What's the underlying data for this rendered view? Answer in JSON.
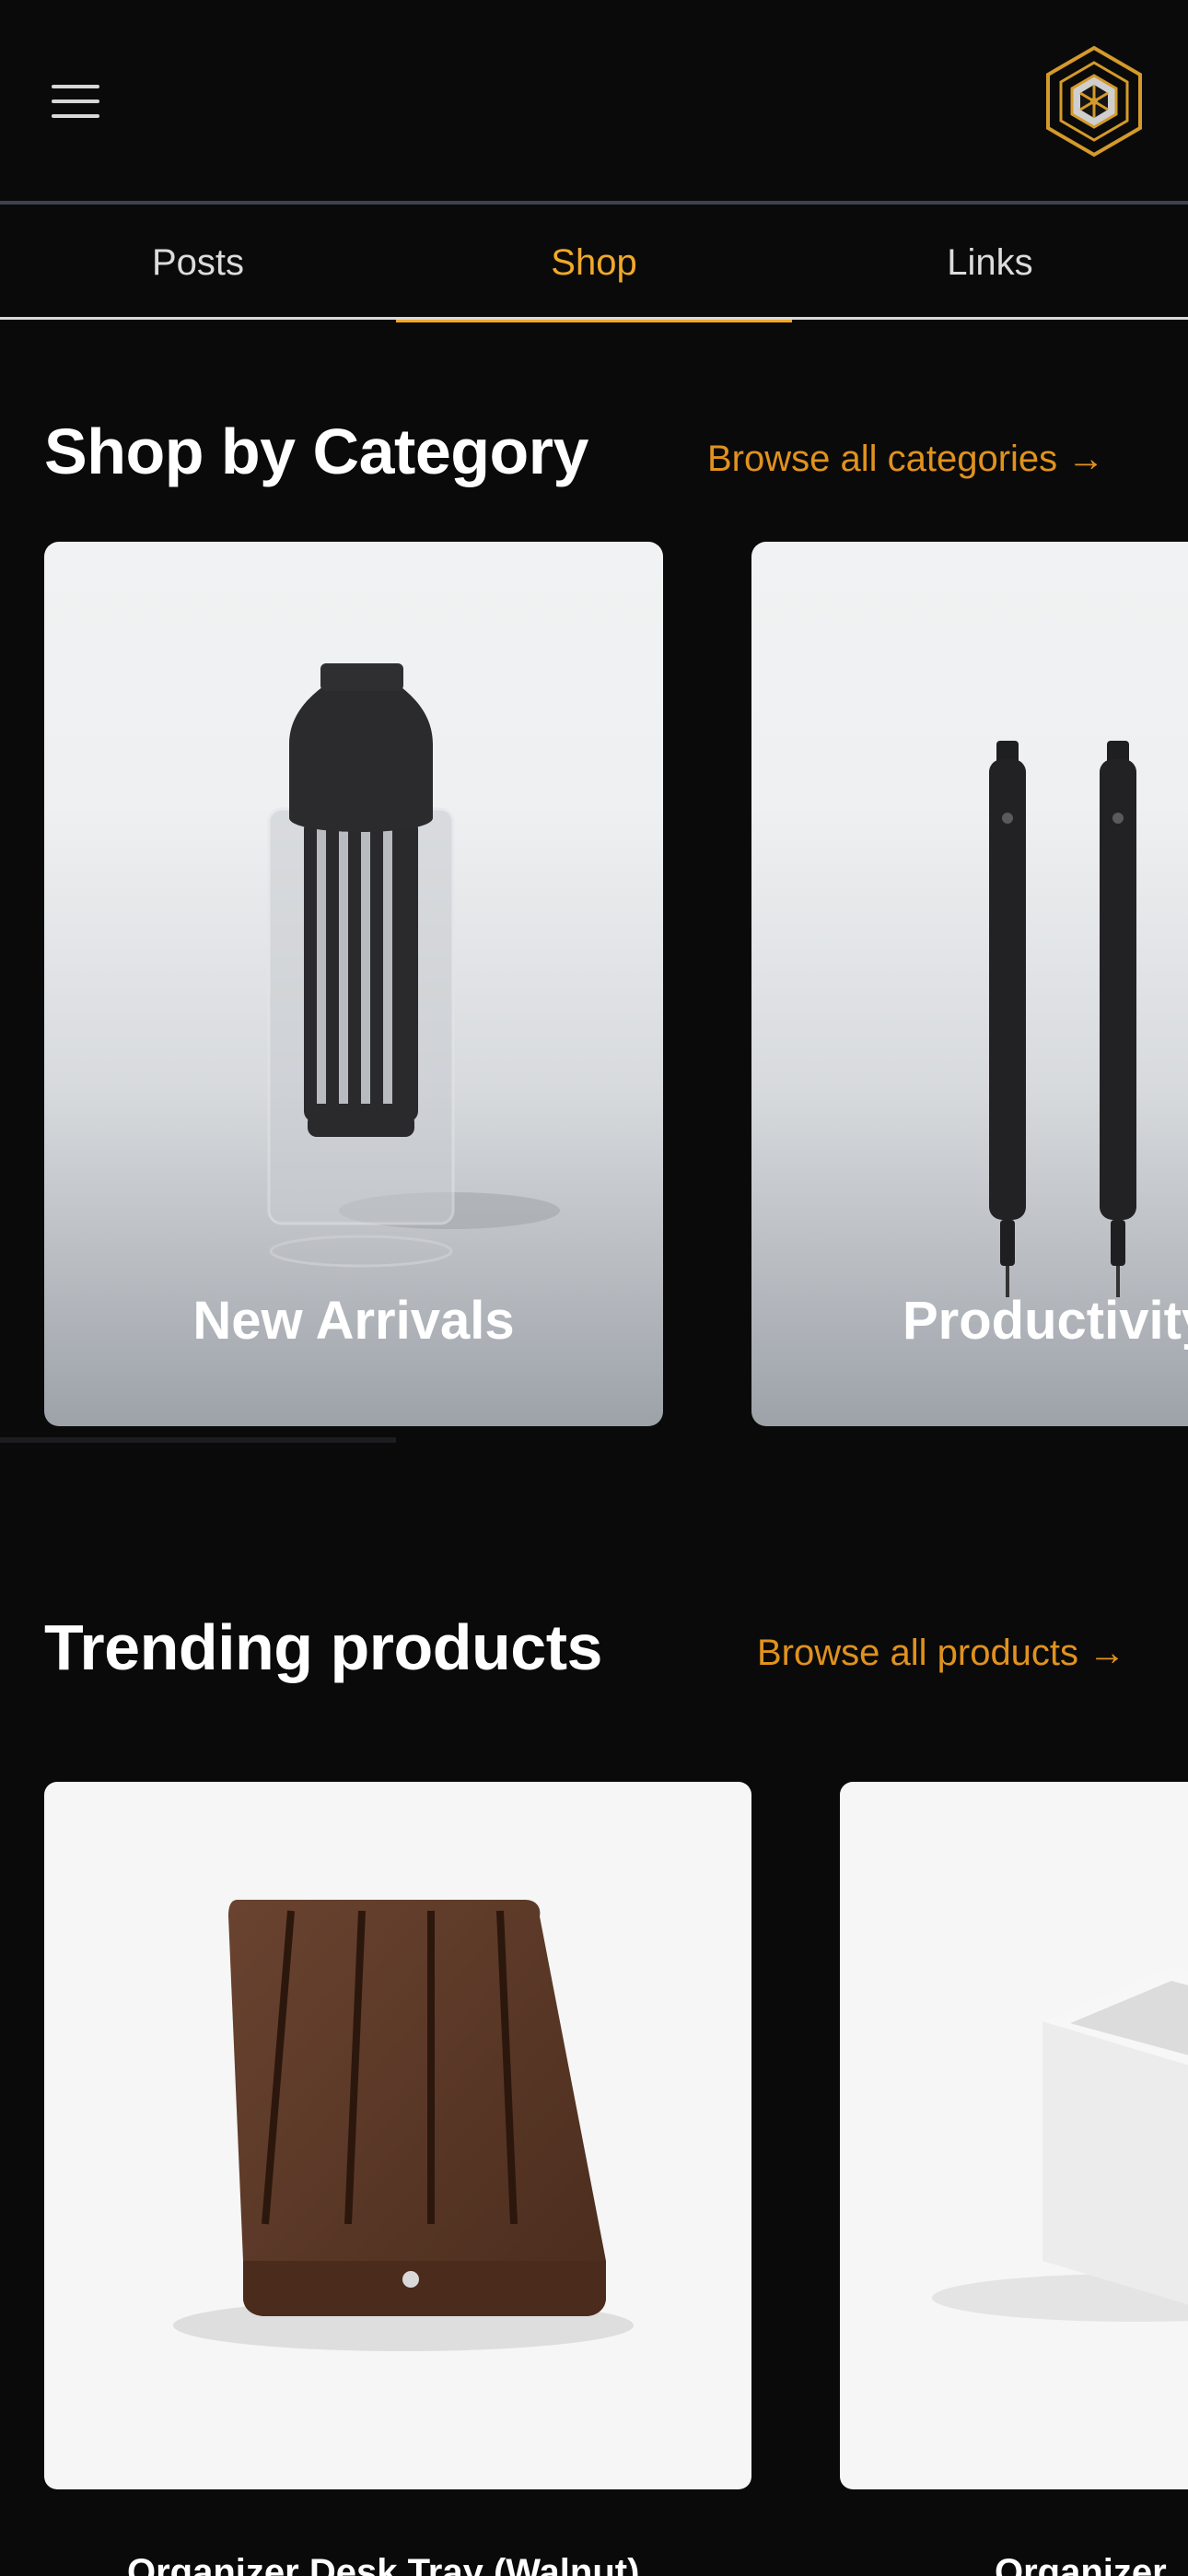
{
  "header": {
    "menu_icon": "hamburger-menu-icon",
    "logo_icon": "hexagon-logo-icon",
    "colors": {
      "background": "#0b0a0a",
      "accent": "#f0a82a",
      "link": "#e0921e"
    }
  },
  "tabs": [
    {
      "label": "Posts",
      "active": false
    },
    {
      "label": "Shop",
      "active": true
    },
    {
      "label": "Links",
      "active": false
    }
  ],
  "categories_section": {
    "title": "Shop by Category",
    "browse_link": "Browse all categories →",
    "cards": [
      {
        "label": "New Arrivals",
        "image_icon": "carafe-image"
      },
      {
        "label": "Productivity",
        "image_icon": "pens-image"
      }
    ]
  },
  "products_section": {
    "title": "Trending products",
    "browse_link": "Browse all products →",
    "cards": [
      {
        "title": "Organizer Desk Tray (Walnut)",
        "image_icon": "walnut-tray-image"
      },
      {
        "title": "Organizer",
        "image_icon": "white-cup-image"
      }
    ]
  }
}
